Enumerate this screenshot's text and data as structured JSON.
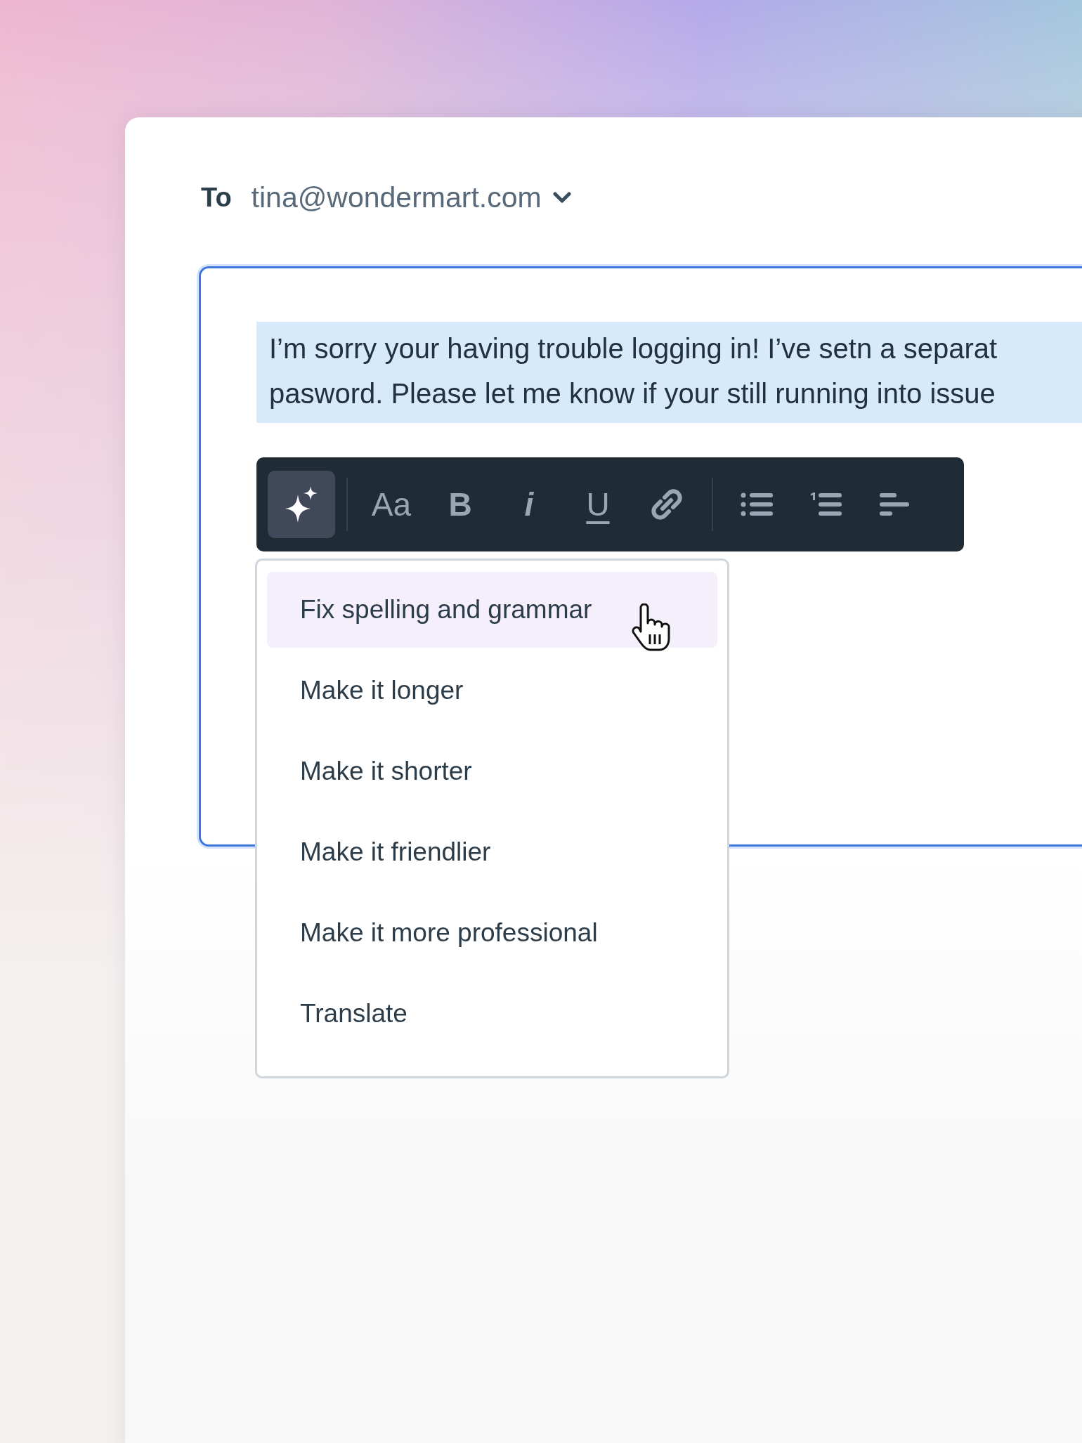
{
  "recipient": {
    "label": "To",
    "value": "tina@wondermart.com"
  },
  "message": {
    "lines": [
      "I’m sorry your having trouble logging in! I’ve setn a separat",
      "pasword. Please let me know if your still running into issue"
    ],
    "selected": true
  },
  "toolbar": [
    {
      "kind": "ai",
      "selected": true
    },
    {
      "kind": "separator"
    },
    {
      "kind": "text",
      "label": "Aa",
      "selected": false
    },
    {
      "kind": "text",
      "label": "B",
      "selected": false
    },
    {
      "kind": "text",
      "label": "i",
      "selected": false
    },
    {
      "kind": "text",
      "label": "U",
      "selected": false
    },
    {
      "kind": "link",
      "selected": false
    },
    {
      "kind": "separator"
    },
    {
      "kind": "bullet-list",
      "selected": false
    },
    {
      "kind": "numbered-list",
      "selected": false
    },
    {
      "kind": "align",
      "selected": false
    }
  ],
  "menu": [
    {
      "label": "Fix spelling and grammar",
      "selected": true
    },
    {
      "label": "Make it longer",
      "selected": false
    },
    {
      "label": "Make it shorter",
      "selected": false
    },
    {
      "label": "Make it friendlier",
      "selected": false
    },
    {
      "label": "Make it more professional",
      "selected": false
    },
    {
      "label": "Translate",
      "selected": false
    }
  ]
}
